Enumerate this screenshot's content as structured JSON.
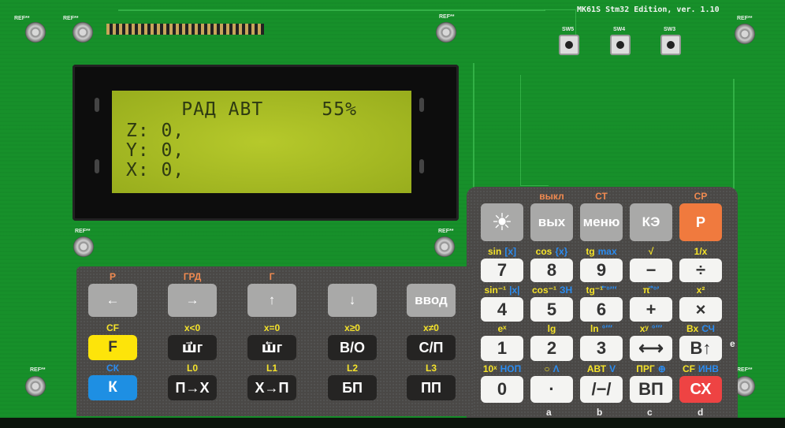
{
  "board": {
    "title": "MK61S Stm32 Edition, ver. 1.10",
    "ref_label": "REF**",
    "switches": [
      "SW5",
      "SW4",
      "SW3"
    ],
    "color": "#17902a"
  },
  "lcd": {
    "lines": [
      "     РАД АВТ     55%",
      "Z: 0,",
      "Y: 0,",
      "X: 0,"
    ],
    "color": "#a4b822"
  },
  "right_keypad": {
    "rows": [
      [
        {
          "key": "☀",
          "style": "gray",
          "top": [],
          "name": "backlight-key"
        },
        {
          "key": "вых",
          "style": "gray",
          "top": [
            {
              "t": "выкл",
              "c": "o"
            }
          ],
          "name": "exit-key"
        },
        {
          "key": "меню",
          "style": "gray",
          "top": [
            {
              "t": "СТ",
              "c": "o"
            }
          ],
          "name": "menu-key"
        },
        {
          "key": "КЭ",
          "style": "gray",
          "top": [],
          "name": "ke-key"
        },
        {
          "key": "Р",
          "style": "orange",
          "top": [
            {
              "t": "СР",
              "c": "o"
            }
          ],
          "name": "r-key"
        }
      ],
      [
        {
          "key": "7",
          "style": "white",
          "top": [
            {
              "t": "sin",
              "c": "y"
            },
            {
              "t": "[x]",
              "c": "b"
            }
          ]
        },
        {
          "key": "8",
          "style": "white",
          "top": [
            {
              "t": "cos",
              "c": "y"
            },
            {
              "t": "{x}",
              "c": "b"
            }
          ]
        },
        {
          "key": "9",
          "style": "white",
          "top": [
            {
              "t": "tg",
              "c": "y"
            },
            {
              "t": "max",
              "c": "b"
            }
          ]
        },
        {
          "key": "−",
          "style": "white",
          "top": [
            {
              "t": "√",
              "c": "y"
            }
          ]
        },
        {
          "key": "÷",
          "style": "white",
          "top": [
            {
              "t": "1/x",
              "c": "y"
            }
          ]
        }
      ],
      [
        {
          "key": "4",
          "style": "white",
          "top": [
            {
              "t": "sin⁻¹",
              "c": "y"
            },
            {
              "t": "|x|",
              "c": "b"
            }
          ]
        },
        {
          "key": "5",
          "style": "white",
          "top": [
            {
              "t": "cos⁻¹",
              "c": "y"
            },
            {
              "t": "ЗН",
              "c": "b"
            }
          ]
        },
        {
          "key": "6",
          "style": "white",
          "top": [
            {
              "t": "tg⁻¹",
              "c": "y"
            },
            {
              "t": "⃖°′″",
              "c": "b"
            }
          ]
        },
        {
          "key": "+",
          "style": "white",
          "top": [
            {
              "t": "π",
              "c": "y"
            },
            {
              "t": "⃗°′",
              "c": "b"
            }
          ]
        },
        {
          "key": "×",
          "style": "white",
          "top": [
            {
              "t": "x²",
              "c": "y"
            }
          ]
        }
      ],
      [
        {
          "key": "1",
          "style": "white",
          "top": [
            {
              "t": "eˣ",
              "c": "y"
            }
          ]
        },
        {
          "key": "2",
          "style": "white",
          "top": [
            {
              "t": "lg",
              "c": "y"
            }
          ]
        },
        {
          "key": "3",
          "style": "white",
          "top": [
            {
              "t": "ln",
              "c": "y"
            },
            {
              "t": "°′″",
              "c": "b"
            }
          ]
        },
        {
          "key": "⟷",
          "style": "white",
          "top": [
            {
              "t": "xʸ",
              "c": "y"
            },
            {
              "t": "°′″",
              "c": "b"
            }
          ]
        },
        {
          "key": "В↑",
          "style": "white",
          "top": [
            {
              "t": "Вх",
              "c": "y"
            },
            {
              "t": "СЧ",
              "c": "b"
            }
          ]
        }
      ],
      [
        {
          "key": "0",
          "style": "white",
          "top": [
            {
              "t": "10ˣ",
              "c": "y"
            },
            {
              "t": "НОП",
              "c": "b"
            }
          ]
        },
        {
          "key": "·",
          "style": "white",
          "top": [
            {
              "t": "○",
              "c": "y"
            },
            {
              "t": "Λ",
              "c": "b"
            }
          ]
        },
        {
          "key": "/−/",
          "style": "white",
          "top": [
            {
              "t": "АВТ",
              "c": "y"
            },
            {
              "t": "V",
              "c": "b"
            }
          ]
        },
        {
          "key": "ВП",
          "style": "white",
          "top": [
            {
              "t": "ПРГ",
              "c": "y"
            },
            {
              "t": "⊕",
              "c": "b"
            }
          ]
        },
        {
          "key": "СХ",
          "style": "red",
          "top": [
            {
              "t": "CF",
              "c": "y"
            },
            {
              "t": "ИНВ",
              "c": "b"
            }
          ]
        }
      ]
    ],
    "side_label": "e",
    "bottom_labels": [
      "a",
      "b",
      "c",
      "d"
    ]
  },
  "left_keypad": {
    "rows": [
      [
        {
          "key": "←",
          "style": "gray",
          "top": [
            {
              "t": "Р",
              "c": "o"
            }
          ]
        },
        {
          "key": "→",
          "style": "gray",
          "top": [
            {
              "t": "ГРД",
              "c": "o"
            }
          ]
        },
        {
          "key": "↑",
          "style": "gray",
          "top": [
            {
              "t": "Г",
              "c": "o"
            }
          ]
        },
        {
          "key": "↓",
          "style": "gray",
          "top": []
        },
        {
          "key": "ввод",
          "style": "gray",
          "top": []
        }
      ],
      [
        {
          "key": "F",
          "style": "yellow",
          "top": [
            {
              "t": "CF",
              "c": "y"
            }
          ]
        },
        {
          "key": "ш⃗г",
          "style": "dark",
          "top": [
            {
              "t": "x<0",
              "c": "y"
            }
          ]
        },
        {
          "key": "ш⃖г",
          "style": "dark",
          "top": [
            {
              "t": "x=0",
              "c": "y"
            }
          ]
        },
        {
          "key": "В/О",
          "style": "dark",
          "top": [
            {
              "t": "x≥0",
              "c": "y"
            }
          ]
        },
        {
          "key": "С/П",
          "style": "dark",
          "top": [
            {
              "t": "x≠0",
              "c": "y"
            }
          ]
        }
      ],
      [
        {
          "key": "К",
          "style": "blue",
          "top": [
            {
              "t": "СК",
              "c": "b"
            }
          ]
        },
        {
          "key": "П→X",
          "style": "dark",
          "top": [
            {
              "t": "L0",
              "c": "y"
            }
          ]
        },
        {
          "key": "X→П",
          "style": "dark",
          "top": [
            {
              "t": "L1",
              "c": "y"
            }
          ]
        },
        {
          "key": "БП",
          "style": "dark",
          "top": [
            {
              "t": "L2",
              "c": "y"
            }
          ]
        },
        {
          "key": "ПП",
          "style": "dark",
          "top": [
            {
              "t": "L3",
              "c": "y"
            }
          ]
        }
      ]
    ]
  }
}
